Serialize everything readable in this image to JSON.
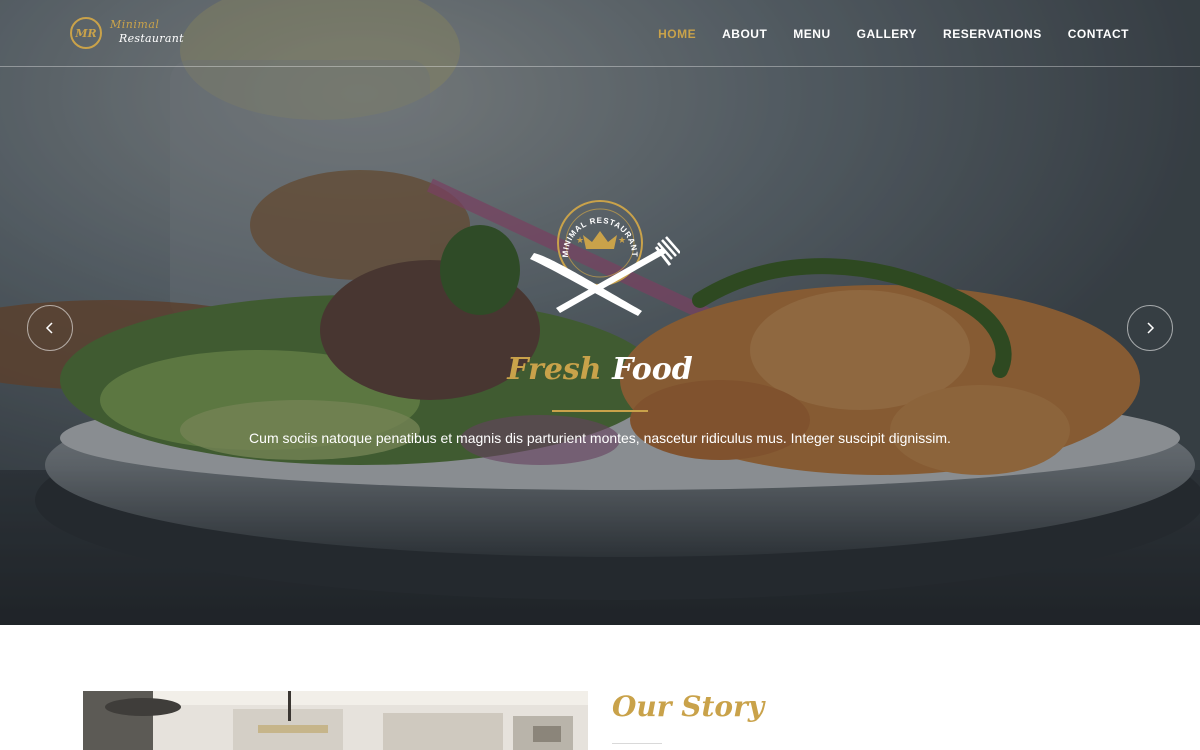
{
  "brand": {
    "monogram": "MR",
    "line1": "Minimal",
    "line2": "Restaurant"
  },
  "nav": {
    "items": [
      {
        "label": "HOME",
        "active": true
      },
      {
        "label": "ABOUT",
        "active": false
      },
      {
        "label": "MENU",
        "active": false
      },
      {
        "label": "GALLERY",
        "active": false
      },
      {
        "label": "RESERVATIONS",
        "active": false
      },
      {
        "label": "CONTACT",
        "active": false
      }
    ]
  },
  "hero": {
    "emblem_text": "MINIMAL RESTAURANT",
    "title_part1": "Fresh",
    "title_part2": "Food",
    "subtitle": "Cum sociis natoque penatibus et magnis dis parturient montes, nascetur ridiculus mus. Integer suscipit dignissim.",
    "prev_icon": "chevron-left-icon",
    "next_icon": "chevron-right-icon"
  },
  "story": {
    "title": "Our Story"
  },
  "colors": {
    "accent": "#c9a24a",
    "nav_text": "#ffffff"
  }
}
